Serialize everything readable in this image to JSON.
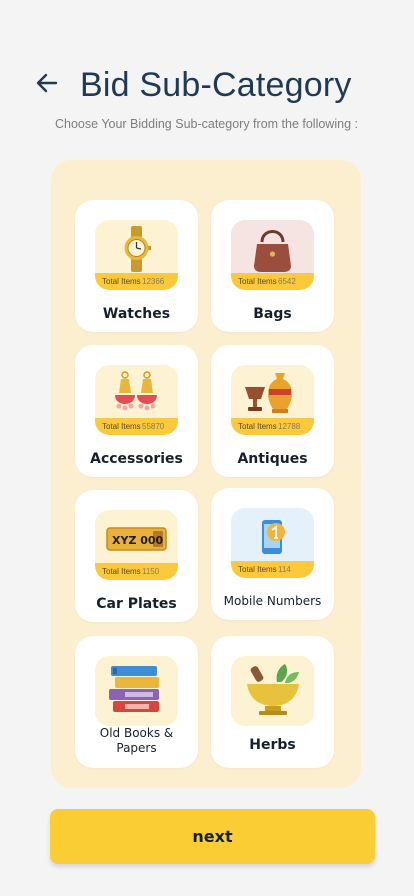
{
  "header": {
    "title": "Bid Sub-Category",
    "subtitle": "Choose Your Bidding Sub-category from the following :"
  },
  "categories": [
    {
      "name": "Watches",
      "items_label": "Total Items",
      "items_count": "12366",
      "icon": "watch-icon"
    },
    {
      "name": "Bags",
      "items_label": "Total Items",
      "items_count": "6542",
      "icon": "handbag-icon"
    },
    {
      "name": "Accessories",
      "items_label": "Total Items",
      "items_count": "55870",
      "icon": "earrings-icon"
    },
    {
      "name": "Antiques",
      "items_label": "Total Items",
      "items_count": "12788",
      "icon": "vase-icon"
    },
    {
      "name": "Car Plates",
      "items_label": "Total Items",
      "items_count": "1150",
      "icon": "license-plate-icon",
      "plate_text": "XYZ 000"
    },
    {
      "name": "Mobile Numbers",
      "items_label": "Total Items",
      "items_count": "114",
      "icon": "mobile-phone-icon"
    },
    {
      "name": "Old Books & Papers",
      "icon": "books-icon"
    },
    {
      "name": "Herbs",
      "icon": "mortar-herbs-icon"
    }
  ],
  "footer": {
    "next_label": "next"
  },
  "colors": {
    "accent": "#fbcd35",
    "panel": "#fbefcf",
    "title": "#1f3a55"
  }
}
